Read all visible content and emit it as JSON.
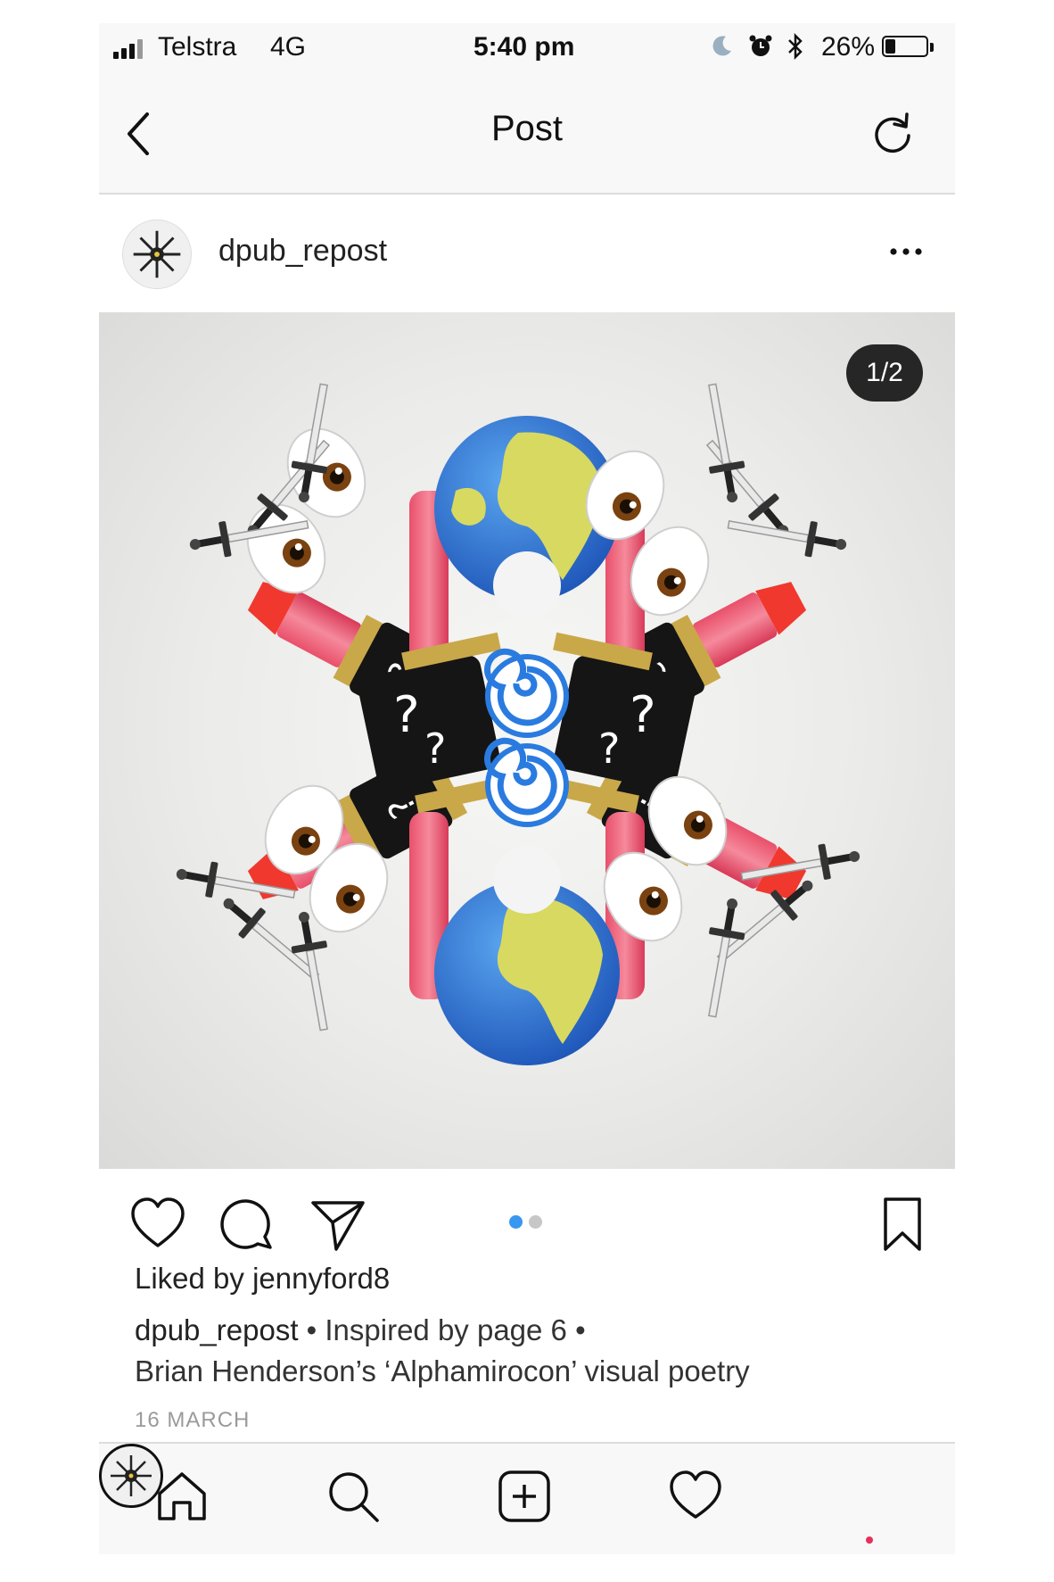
{
  "status_bar": {
    "carrier": "Telstra",
    "network": "4G",
    "time": "5:40 pm",
    "battery_percent_text": "26%",
    "battery_level": 0.26,
    "signal_bars_filled": 4,
    "icons": [
      "signal-icon",
      "moon-icon",
      "alarm-icon",
      "bluetooth-icon",
      "battery-icon"
    ]
  },
  "nav": {
    "title": "Post",
    "back_icon": "chevron-left-icon",
    "refresh_icon": "refresh-icon"
  },
  "post": {
    "username": "dpub_repost",
    "more_icon": "more-horizontal-icon",
    "media": {
      "counter": "1/2",
      "artwork_motifs": [
        "globe-emoji",
        "lipstick-emoji",
        "eyes-emoji",
        "dagger-emoji",
        "swirl-emoji",
        "question-mark",
        "moon-emoji"
      ]
    },
    "actions": {
      "icons": [
        "heart-icon",
        "comment-icon",
        "share-icon",
        "bookmark-icon"
      ],
      "carousel_current": 1,
      "carousel_total": 2,
      "active_dot_color": "#3897f0",
      "inactive_dot_color": "#c7c7c7"
    },
    "liked_by_prefix": "Liked by",
    "liked_by_user": "jennyford8",
    "caption_user": "dpub_repost",
    "caption_line1": " • Inspired by page 6 •",
    "caption_line2": "Brian Henderson’s ‘Alphamirocon’ visual poetry",
    "date": "16 MARCH"
  },
  "tab_bar": {
    "tabs": [
      "home-icon",
      "search-icon",
      "new-post-icon",
      "activity-heart-icon",
      "profile-avatar"
    ],
    "notification_color": "#e6305a"
  }
}
